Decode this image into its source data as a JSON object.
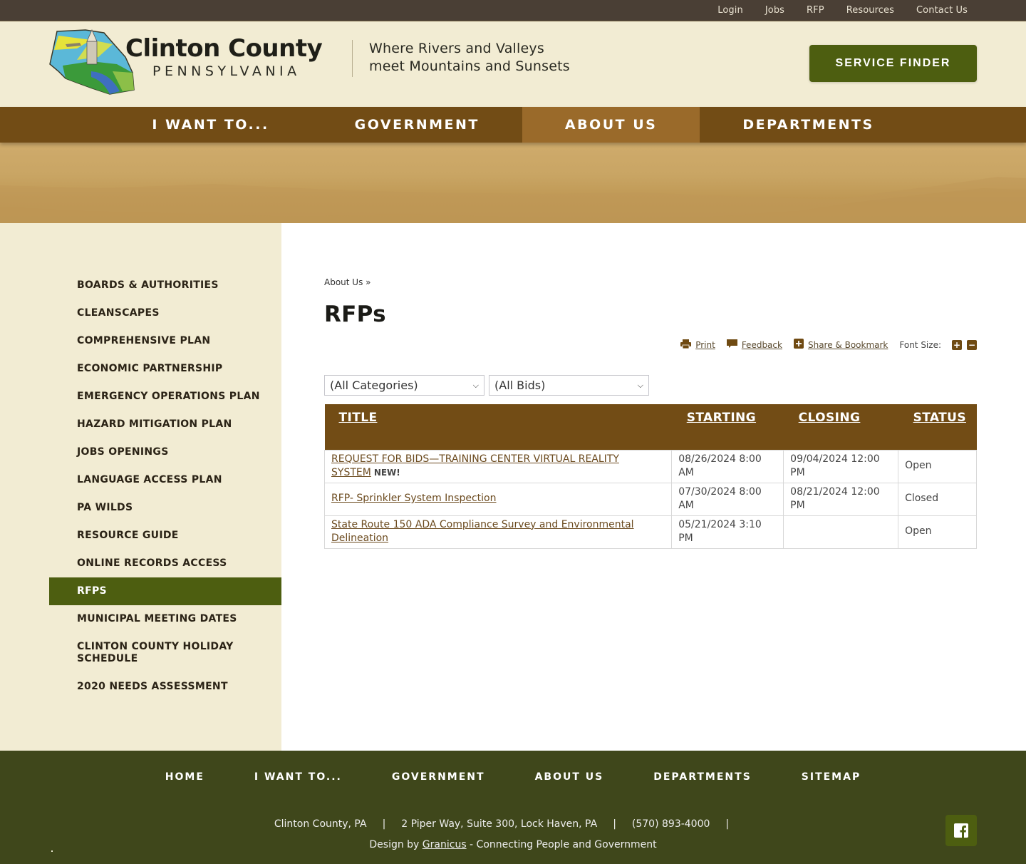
{
  "utility_nav": [
    "Login",
    "Jobs",
    "RFP",
    "Resources",
    "Contact Us"
  ],
  "header": {
    "brand_name": "Clinton County",
    "brand_state": "PENNSYLVANIA",
    "tagline_line1": "Where Rivers and Valleys",
    "tagline_line2": "meet Mountains and Sunsets",
    "service_finder": "SERVICE FINDER"
  },
  "main_nav": [
    {
      "label": "I WANT TO...",
      "active": false
    },
    {
      "label": "GOVERNMENT",
      "active": false
    },
    {
      "label": "ABOUT US",
      "active": true
    },
    {
      "label": "DEPARTMENTS",
      "active": false
    }
  ],
  "sidebar": {
    "items": [
      {
        "label": "BOARDS & AUTHORITIES"
      },
      {
        "label": "CLEANSCAPES"
      },
      {
        "label": "COMPREHENSIVE PLAN"
      },
      {
        "label": "ECONOMIC PARTNERSHIP"
      },
      {
        "label": "EMERGENCY OPERATIONS PLAN"
      },
      {
        "label": "HAZARD MITIGATION PLAN"
      },
      {
        "label": "JOBS OPENINGS"
      },
      {
        "label": "LANGUAGE ACCESS PLAN"
      },
      {
        "label": "PA WILDS"
      },
      {
        "label": "RESOURCE GUIDE"
      },
      {
        "label": "ONLINE RECORDS ACCESS"
      },
      {
        "label": "RFPS",
        "active": true
      },
      {
        "label": "MUNICIPAL MEETING DATES"
      },
      {
        "label": "CLINTON COUNTY HOLIDAY SCHEDULE"
      },
      {
        "label": "2020 NEEDS ASSESSMENT"
      }
    ]
  },
  "main": {
    "breadcrumb": "About Us »",
    "title": "RFPs",
    "tools": {
      "print": "Print",
      "feedback": "Feedback",
      "share": "Share & Bookmark",
      "font_size_label": "Font Size:",
      "font_increase": "+",
      "font_decrease": "−"
    },
    "filters": {
      "category": "(All Categories)",
      "bids": "(All Bids)"
    },
    "table": {
      "headers": [
        "TITLE",
        "STARTING",
        "CLOSING",
        "STATUS"
      ],
      "rows": [
        {
          "title": "REQUEST FOR BIDS—TRAINING CENTER VIRTUAL REALITY SYSTEM",
          "badge": "NEW!",
          "starting": "08/26/2024 8:00 AM",
          "closing": "09/04/2024 12:00 PM",
          "status": "Open"
        },
        {
          "title": "RFP- Sprinkler System Inspection",
          "badge": "",
          "starting": "07/30/2024 8:00 AM",
          "closing": "08/21/2024 12:00 PM",
          "status": "Closed"
        },
        {
          "title": "State Route 150 ADA Compliance Survey and Environmental Delineation",
          "badge": "",
          "starting": "05/21/2024 3:10 PM",
          "closing": "",
          "status": "Open"
        }
      ]
    }
  },
  "footer": {
    "nav": [
      "HOME",
      "I WANT TO...",
      "GOVERNMENT",
      "ABOUT US",
      "DEPARTMENTS",
      "SITEMAP"
    ],
    "info": [
      "Clinton County, PA",
      "2 Piper Way, Suite 300, Lock Haven, PA",
      "(570) 893-4000"
    ],
    "separator": "|",
    "credit_prefix": "Design by ",
    "credit_link": "Granicus",
    "credit_suffix": " - Connecting People and Government",
    "social": "facebook"
  },
  "colors": {
    "brand_brown": "#724c15",
    "active_nav": "#9a6a2a",
    "brand_green": "#4d5e10",
    "cream": "#f2ecd3",
    "footer_green": "#3f471b"
  }
}
